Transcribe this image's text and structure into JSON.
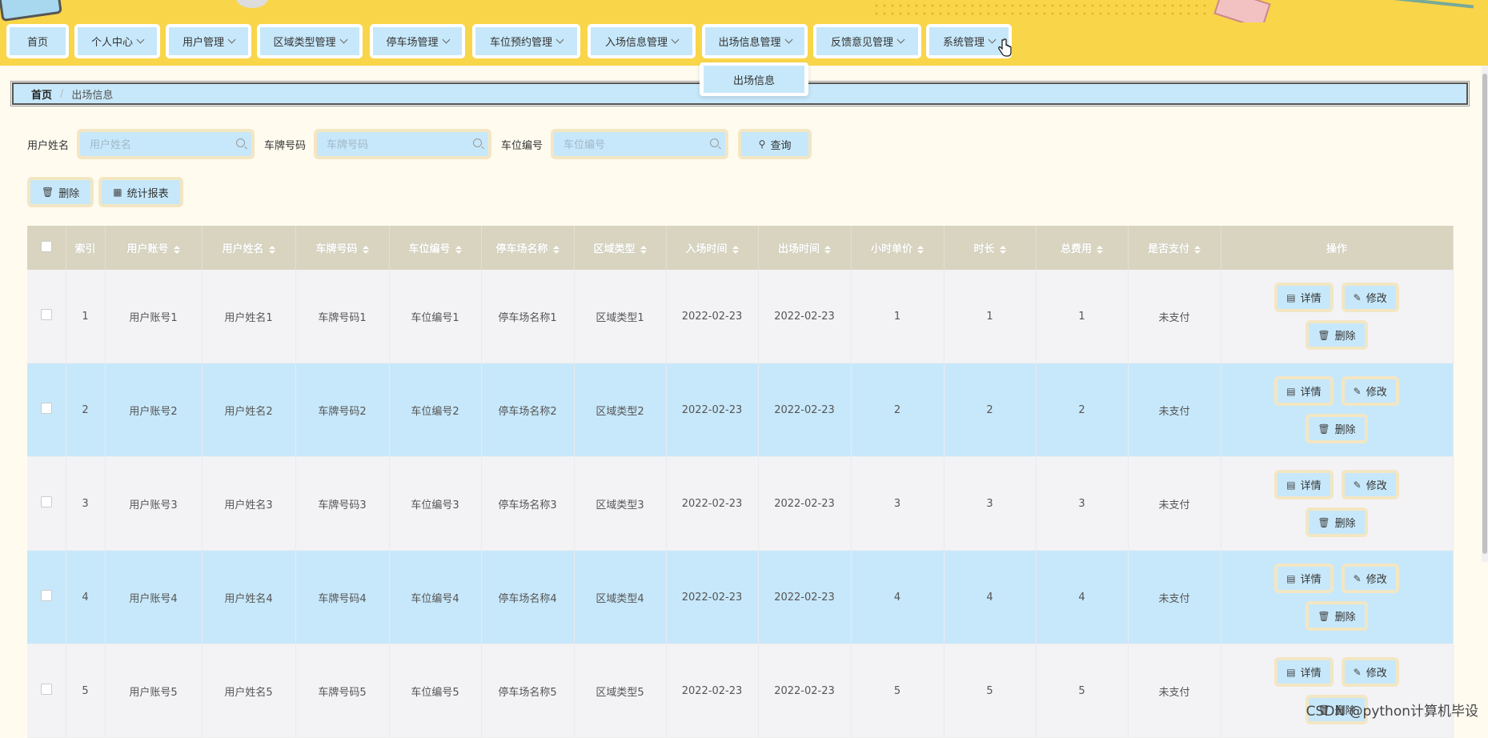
{
  "nav": {
    "items": [
      {
        "label": "首页",
        "has_arrow": false
      },
      {
        "label": "个人中心",
        "has_arrow": true
      },
      {
        "label": "用户管理",
        "has_arrow": true
      },
      {
        "label": "区域类型管理",
        "has_arrow": true
      },
      {
        "label": "停车场管理",
        "has_arrow": true
      },
      {
        "label": "车位预约管理",
        "has_arrow": true
      },
      {
        "label": "入场信息管理",
        "has_arrow": true
      },
      {
        "label": "出场信息管理",
        "has_arrow": true
      },
      {
        "label": "反馈意见管理",
        "has_arrow": true
      },
      {
        "label": "系统管理",
        "has_arrow": true
      }
    ],
    "dropdown": {
      "item": "出场信息"
    }
  },
  "breadcrumb": {
    "home": "首页",
    "separator": "/",
    "current": "出场信息"
  },
  "search": {
    "user_name_label": "用户姓名",
    "user_name_placeholder": "用户姓名",
    "plate_label": "车牌号码",
    "plate_placeholder": "车牌号码",
    "space_label": "车位编号",
    "space_placeholder": "车位编号",
    "query_label": "查询"
  },
  "actions": {
    "delete_label": "删除",
    "stats_label": "统计报表"
  },
  "table": {
    "headers": [
      "索引",
      "用户账号",
      "用户姓名",
      "车牌号码",
      "车位编号",
      "停车场名称",
      "区域类型",
      "入场时间",
      "出场时间",
      "小时单价",
      "时长",
      "总费用",
      "是否支付",
      "操作"
    ],
    "rows": [
      {
        "index": "1",
        "account": "用户账号1",
        "name": "用户姓名1",
        "plate": "车牌号码1",
        "space": "车位编号1",
        "lot": "停车场名称1",
        "area": "区域类型1",
        "in_time": "2022-02-23",
        "out_time": "2022-02-23",
        "price": "1",
        "duration": "1",
        "total": "1",
        "paid": "未支付"
      },
      {
        "index": "2",
        "account": "用户账号2",
        "name": "用户姓名2",
        "plate": "车牌号码2",
        "space": "车位编号2",
        "lot": "停车场名称2",
        "area": "区域类型2",
        "in_time": "2022-02-23",
        "out_time": "2022-02-23",
        "price": "2",
        "duration": "2",
        "total": "2",
        "paid": "未支付"
      },
      {
        "index": "3",
        "account": "用户账号3",
        "name": "用户姓名3",
        "plate": "车牌号码3",
        "space": "车位编号3",
        "lot": "停车场名称3",
        "area": "区域类型3",
        "in_time": "2022-02-23",
        "out_time": "2022-02-23",
        "price": "3",
        "duration": "3",
        "total": "3",
        "paid": "未支付"
      },
      {
        "index": "4",
        "account": "用户账号4",
        "name": "用户姓名4",
        "plate": "车牌号码4",
        "space": "车位编号4",
        "lot": "停车场名称4",
        "area": "区域类型4",
        "in_time": "2022-02-23",
        "out_time": "2022-02-23",
        "price": "4",
        "duration": "4",
        "total": "4",
        "paid": "未支付"
      },
      {
        "index": "5",
        "account": "用户账号5",
        "name": "用户姓名5",
        "plate": "车牌号码5",
        "space": "车位编号5",
        "lot": "停车场名称5",
        "area": "区域类型5",
        "in_time": "2022-02-23",
        "out_time": "2022-02-23",
        "price": "5",
        "duration": "5",
        "total": "5",
        "paid": "未支付"
      }
    ],
    "op_labels": {
      "detail": "详情",
      "edit": "修改",
      "delete": "删除"
    }
  },
  "watermark": "CSDN @python计算机毕设",
  "colors": {
    "nav_bg": "#f9d54a",
    "button_fill": "#c7e8fa",
    "button_border": "#f3e6c3",
    "page_bg": "#fffbef",
    "header_bg": "#d8d4c0"
  }
}
